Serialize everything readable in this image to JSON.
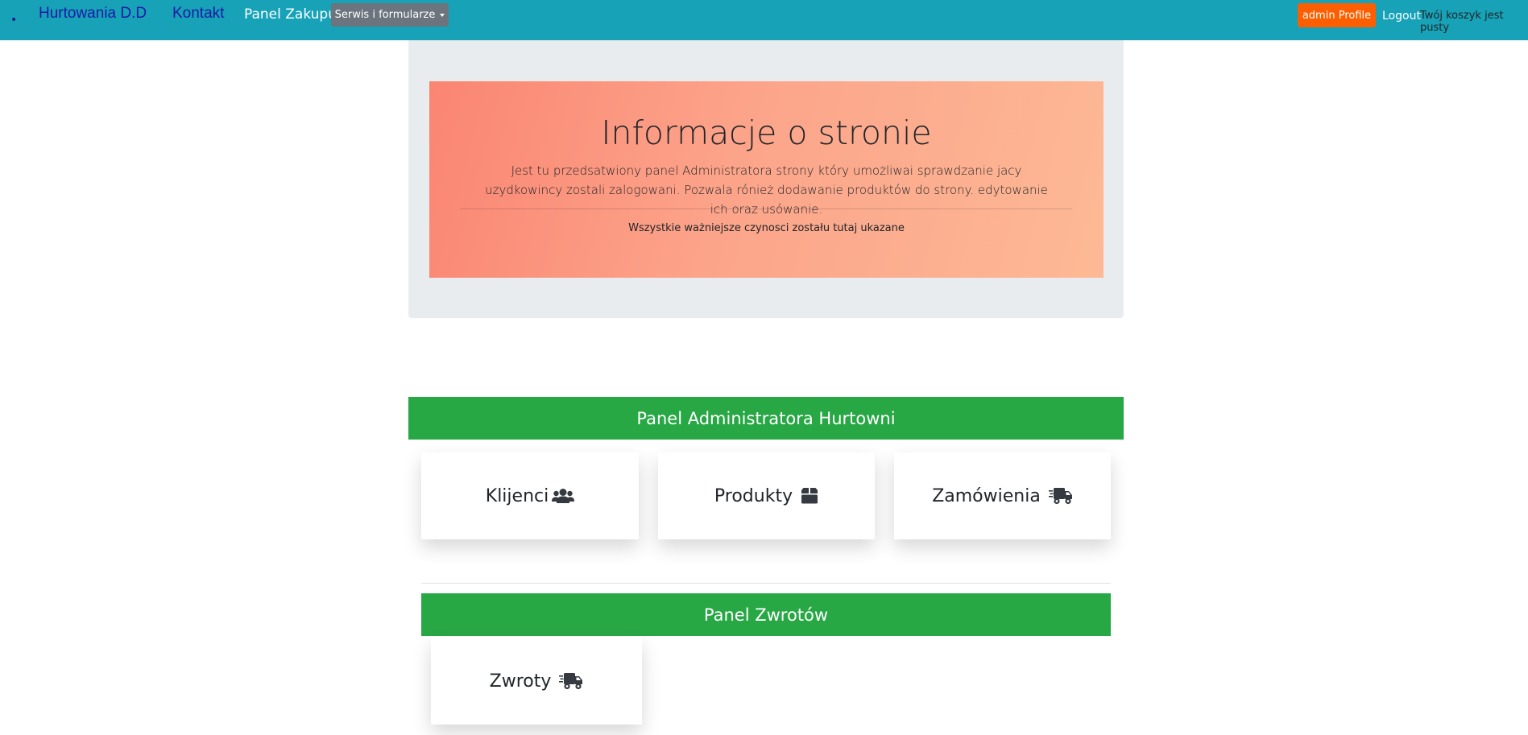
{
  "navbar": {
    "bullet": "•",
    "brand": "Hurtowania D.D",
    "kontakt": "Kontakt",
    "panel_zakupu": "Panel Zakupu",
    "dropdown_label": "Serwis i formularze",
    "admin_profile": "admin Profile",
    "logout": "Logout",
    "cart": "Twój koszyk jest pusty"
  },
  "info": {
    "title": "Informacje o stronie",
    "text": "Jest tu przedsatwiony panel Administratora strony który umożliwai sprawdzanie jacy uzydkowincy zostali zalogowani. Pozwala rónież dodawanie produktów do strony. edytowanie ich oraz usówanie.",
    "note": "Wszystkie ważniejsze czynosci zostału tutaj ukazane"
  },
  "admin_panel": {
    "header": "Panel Administratora Hurtowni",
    "cards": [
      {
        "label": "Klijenci",
        "icon": "users-icon"
      },
      {
        "label": "Produkty",
        "icon": "box-icon"
      },
      {
        "label": "Zamówienia",
        "icon": "truck-icon"
      }
    ]
  },
  "returns_panel": {
    "header": "Panel Zwrotów",
    "cards": [
      {
        "label": "Zwroty",
        "icon": "truck-icon"
      }
    ]
  },
  "colors": {
    "navbar": "#17a2b8",
    "success": "#28a745",
    "admin_button": "#fd5f00",
    "dropdown": "#6c757d"
  }
}
